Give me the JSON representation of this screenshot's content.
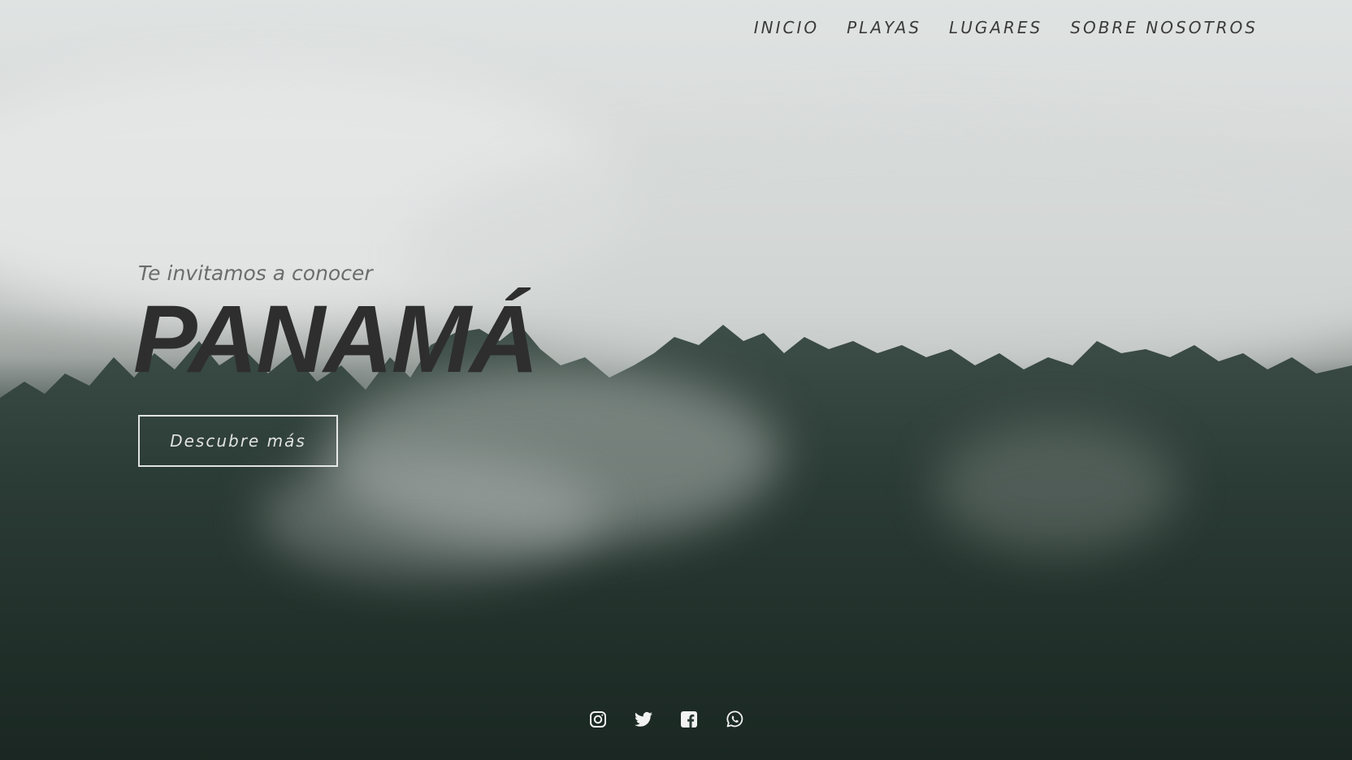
{
  "nav": {
    "items": [
      {
        "label": "INICIO"
      },
      {
        "label": "PLAYAS"
      },
      {
        "label": "LUGARES"
      },
      {
        "label": "SOBRE NOSOTROS"
      }
    ]
  },
  "hero": {
    "tagline": "Te invitamos a conocer",
    "title": "PANAMÁ",
    "cta_label": "Descubre más"
  },
  "social": {
    "icons": [
      "instagram-icon",
      "twitter-icon",
      "facebook-icon",
      "whatsapp-icon"
    ]
  },
  "colors": {
    "nav_text": "#3b3b3b",
    "title_text": "#2e2e2e",
    "button_border": "#ffffff",
    "forest_dark": "#1e2c27",
    "fog_light": "#dfe3e2"
  }
}
